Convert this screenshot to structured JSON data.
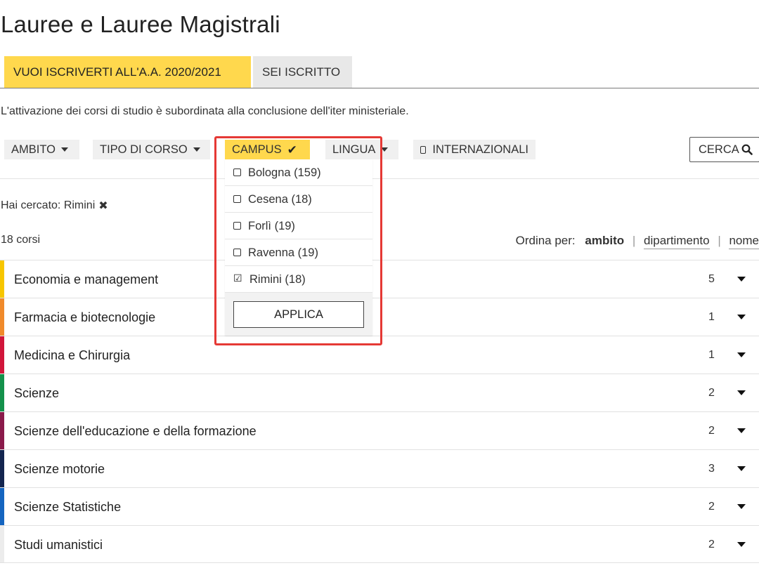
{
  "page": {
    "title": "Lauree e Lauree Magistrali"
  },
  "tabs": [
    {
      "label": "VUOI ISCRIVERTI ALL'A.A. 2020/2021",
      "active": true
    },
    {
      "label": "SEI ISCRITTO",
      "active": false
    }
  ],
  "notice": "L'attivazione dei corsi di studio è subordinata alla conclusione dell'iter ministeriale.",
  "filters": {
    "ambito": "AMBITO",
    "tipo": "TIPO DI CORSO",
    "campus": "CAMPUS",
    "lingua": "LINGUA",
    "internazionali": "INTERNAZIONALI",
    "search_label": "CERCA"
  },
  "campus_dropdown": {
    "options": [
      {
        "label": "Bologna (159)",
        "checked": false
      },
      {
        "label": "Cesena (18)",
        "checked": false
      },
      {
        "label": "Forlì (19)",
        "checked": false
      },
      {
        "label": "Ravenna (19)",
        "checked": false
      },
      {
        "label": "Rimini (18)",
        "checked": true
      }
    ],
    "apply_label": "APPLICA"
  },
  "search_summary": {
    "label": "Hai cercato: Rimini"
  },
  "results": {
    "count_label": "18 corsi",
    "sort_label": "Ordina per:",
    "sort_options": [
      "ambito",
      "dipartimento",
      "nome"
    ],
    "active_sort": "ambito"
  },
  "areas": [
    {
      "name": "Economia e management",
      "count": "5",
      "color": "#f7c600"
    },
    {
      "name": "Farmacia e biotecnologie",
      "count": "1",
      "color": "#f08a2b"
    },
    {
      "name": "Medicina e Chirurgia",
      "count": "1",
      "color": "#d1163a"
    },
    {
      "name": "Scienze",
      "count": "2",
      "color": "#13914b"
    },
    {
      "name": "Scienze dell'educazione e della formazione",
      "count": "2",
      "color": "#8a1a4a"
    },
    {
      "name": "Scienze motorie",
      "count": "3",
      "color": "#13254f"
    },
    {
      "name": "Scienze Statistiche",
      "count": "2",
      "color": "#1565c0"
    },
    {
      "name": "Studi umanistici",
      "count": "2",
      "color": "#ececec"
    }
  ],
  "colors": {
    "accent": "#ffd84d",
    "highlight": "#e53935"
  }
}
